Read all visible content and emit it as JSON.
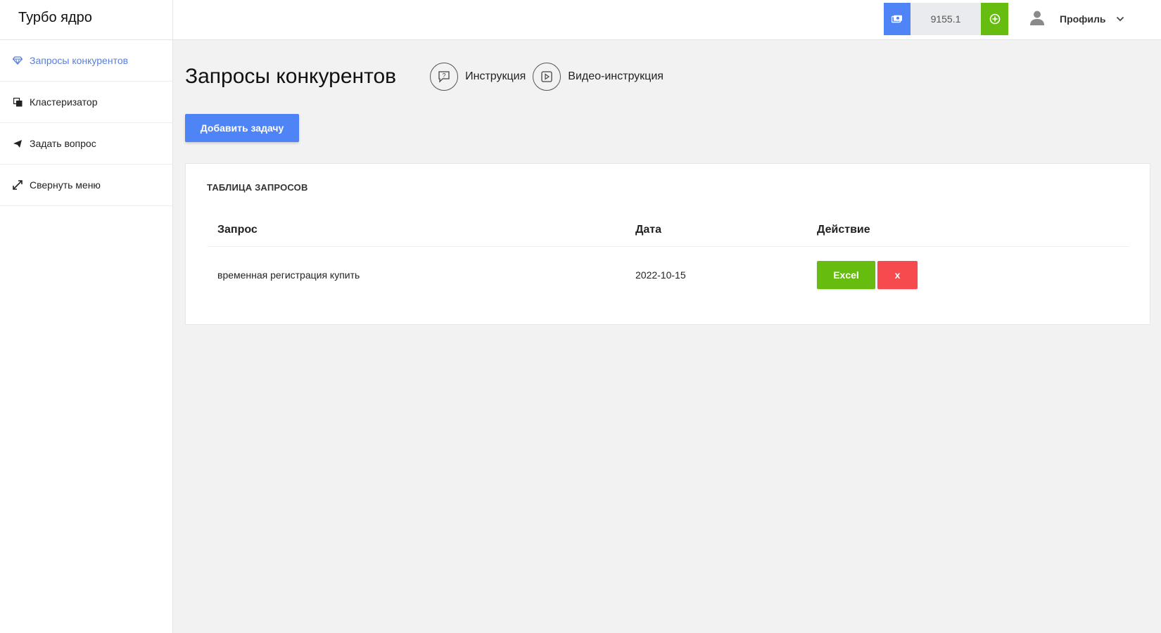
{
  "app": {
    "brand": "Турбо ядро"
  },
  "topbar": {
    "balance_icon": "money-icon",
    "balance_value": "9155.1",
    "add_balance_icon": "plus-circle-icon",
    "profile_icon": "user-icon",
    "profile_label": "Профиль",
    "profile_chevron": "chevron-down-icon"
  },
  "sidebar": {
    "items": [
      {
        "label": "Запросы конкурентов",
        "icon": "diamond-icon",
        "active": true
      },
      {
        "label": "Кластеризатор",
        "icon": "copy-icon",
        "active": false
      },
      {
        "label": "Задать вопрос",
        "icon": "paper-plane-icon",
        "active": false
      },
      {
        "label": "Свернуть меню",
        "icon": "expand-arrows-icon",
        "active": false
      }
    ]
  },
  "main": {
    "title": "Запросы конкурентов",
    "help_links": [
      {
        "label": "Инструкция",
        "icon": "question-chat-icon"
      },
      {
        "label": "Видео-инструкция",
        "icon": "play-icon"
      }
    ],
    "add_task_label": "Добавить задачу",
    "table": {
      "title": "ТАБЛИЦА ЗАПРОСОВ",
      "columns": [
        "Запрос",
        "Дата",
        "Действие"
      ],
      "rows": [
        {
          "query": "временная регистрация купить",
          "date": "2022-10-15",
          "excel_label": "Excel",
          "delete_label": "x"
        }
      ]
    }
  },
  "colors": {
    "primary": "#4f84f6",
    "success": "#66bd10",
    "danger": "#f64a4f",
    "active_link": "#5b7fd6"
  }
}
